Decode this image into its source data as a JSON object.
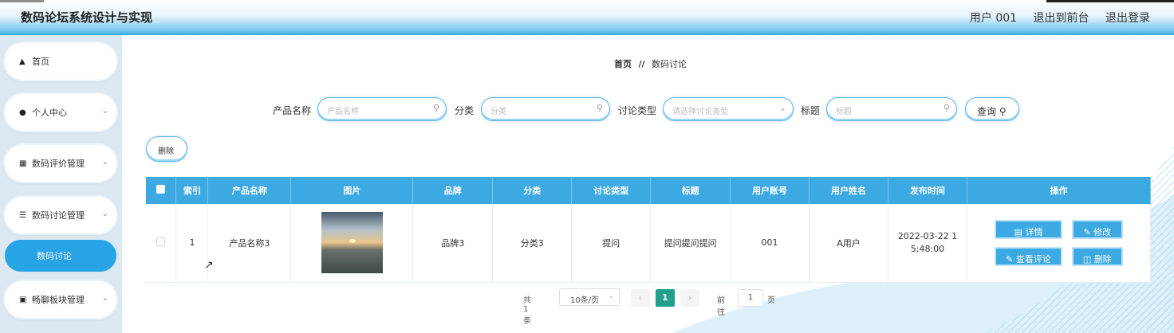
{
  "app": {
    "title": "数码论坛系统设计与实现",
    "user_label": "用户 001",
    "exit_front": "退出到前台",
    "logout": "退出登录"
  },
  "sidebar": {
    "items": [
      {
        "label": "首页",
        "icon": "home-icon"
      },
      {
        "label": "个人中心",
        "icon": "user-icon"
      },
      {
        "label": "数码评价管理",
        "icon": "grid-icon"
      },
      {
        "label": "数码讨论管理",
        "icon": "list-icon"
      },
      {
        "label": "数码讨论",
        "icon": ""
      },
      {
        "label": "畅聊板块管理",
        "icon": "clipboard-icon"
      }
    ]
  },
  "breadcrumb": {
    "home": "首页",
    "separator": "//",
    "current": "数码讨论"
  },
  "search": {
    "product_label": "产品名称",
    "product_placeholder": "产品名称",
    "category_label": "分类",
    "category_placeholder": "分类",
    "type_label": "讨论类型",
    "type_placeholder": "请选择讨论类型",
    "title_label": "标题",
    "title_placeholder": "标题",
    "query_button": "查询"
  },
  "toolbar": {
    "delete_button": "删除"
  },
  "table": {
    "headers": [
      "索引",
      "产品名称",
      "图片",
      "品牌",
      "分类",
      "讨论类型",
      "标题",
      "用户账号",
      "用户姓名",
      "发布时间",
      "操作"
    ],
    "rows": [
      {
        "index": "1",
        "product": "产品名称3",
        "brand": "品牌3",
        "category": "分类3",
        "type": "提问",
        "title": "提问提问提问",
        "account": "001",
        "name": "A用户",
        "time": "2022-03-22 15:48:00",
        "actions": {
          "detail": "详情",
          "edit": "修改",
          "comments": "查看评论",
          "delete": "删除"
        }
      }
    ]
  },
  "pagination": {
    "total": "共 1 条",
    "page_size": "10条/页",
    "current_page": "1",
    "goto_label": "前往",
    "goto_value": "1",
    "page_unit": "页"
  },
  "colors": {
    "accent": "#3da9e2",
    "active_page": "#21a08b",
    "header_bar": "#39ace6"
  }
}
